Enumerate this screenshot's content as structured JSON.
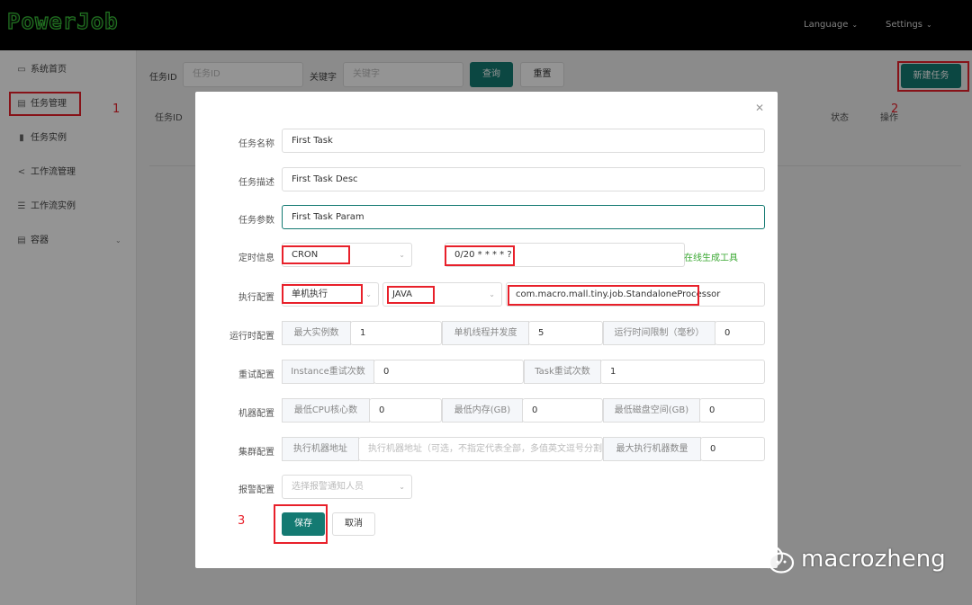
{
  "header": {
    "logo": "PowerJob",
    "language": "Language",
    "settings": "Settings"
  },
  "sidebar": {
    "items": [
      {
        "label": "系统首页",
        "icon": "monitor-icon"
      },
      {
        "label": "任务管理",
        "icon": "task-icon"
      },
      {
        "label": "任务实例",
        "icon": "bar-chart-icon"
      },
      {
        "label": "工作流管理",
        "icon": "share-icon"
      },
      {
        "label": "工作流实例",
        "icon": "sliders-icon"
      },
      {
        "label": "容器",
        "icon": "container-icon"
      }
    ]
  },
  "search": {
    "task_id_label": "任务ID",
    "task_id_placeholder": "任务ID",
    "keyword_label": "关键字",
    "keyword_placeholder": "关键字",
    "query_button": "查询",
    "reset_button": "重置",
    "new_task_button": "新建任务"
  },
  "table": {
    "headers": {
      "id": "任务ID",
      "status": "状态",
      "action": "操作"
    }
  },
  "annotations": {
    "one": "1",
    "two": "2",
    "three": "3"
  },
  "form": {
    "name_label": "任务名称",
    "name_value": "First Task",
    "desc_label": "任务描述",
    "desc_value": "First Task Desc",
    "param_label": "任务参数",
    "param_value": "First Task Param",
    "schedule_label": "定时信息",
    "schedule_type": "CRON",
    "cron_expression": "0/20 * * * * ?",
    "online_tool_link": "在线生成工具",
    "exec_label": "执行配置",
    "exec_type": "单机执行",
    "processor_type": "JAVA",
    "processor_info": "com.macro.mall.tiny.job.StandaloneProcessor",
    "runtime_label": "运行时配置",
    "max_instance_label": "最大实例数",
    "max_instance_value": "1",
    "thread_concurrency_label": "单机线程并发度",
    "thread_concurrency_value": "5",
    "time_limit_label": "运行时间限制（毫秒）",
    "time_limit_value": "0",
    "retry_label": "重试配置",
    "instance_retry_label": "Instance重试次数",
    "instance_retry_value": "0",
    "task_retry_label": "Task重试次数",
    "task_retry_value": "1",
    "machine_label": "机器配置",
    "min_cpu_label": "最低CPU核心数",
    "min_cpu_value": "0",
    "min_mem_label": "最低内存(GB)",
    "min_mem_value": "0",
    "min_disk_label": "最低磁盘空间(GB)",
    "min_disk_value": "0",
    "cluster_label": "集群配置",
    "exec_machine_label": "执行机器地址",
    "exec_machine_placeholder": "执行机器地址（可选，不指定代表全部，多值英文逗号分割",
    "max_machine_label": "最大执行机器数量",
    "max_machine_value": "0",
    "alarm_label": "报警配置",
    "alarm_placeholder": "选择报警通知人员",
    "save_button": "保存",
    "cancel_button": "取消"
  },
  "watermark": {
    "text": "macrozheng"
  },
  "colors": {
    "teal": "#147a72",
    "annotation_red": "#e8202a",
    "link_green": "#3aa832"
  }
}
